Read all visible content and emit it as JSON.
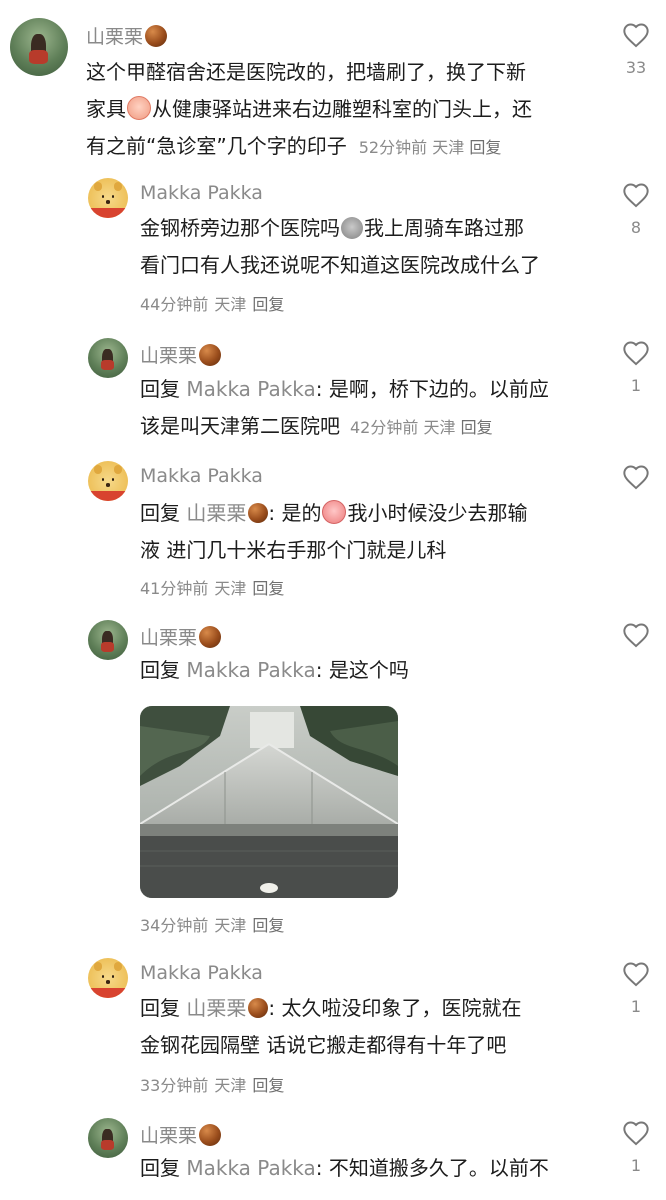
{
  "comments": [
    {
      "username": "山栗栗",
      "text": [
        "这个甲醛宿舍还是医院改的，把墙刷了，换了下新",
        "家具",
        "从健康驿站进来右边雕塑科室的门头上，还",
        "有之前“急诊室”几个字的印子"
      ],
      "time": "52分钟前",
      "location": "天津",
      "reply_label": "回复",
      "likes": "33"
    },
    {
      "username": "Makka Pakka",
      "text": [
        "金钢桥旁边那个医院吗",
        "我上周骑车路过那",
        "看门口有人我还说呢不知道这医院改成什么了"
      ],
      "time": "44分钟前",
      "location": "天津",
      "reply_label": "回复",
      "likes": "8"
    },
    {
      "username": "山栗栗",
      "reply_prefix": "回复",
      "reply_to": "Makka Pakka",
      "text": [
        ": 是啊，桥下边的。以前应",
        "该是叫天津第二医院吧"
      ],
      "time": "42分钟前",
      "location": "天津",
      "reply_label": "回复",
      "likes": "1"
    },
    {
      "username": "Makka Pakka",
      "reply_prefix": "回复",
      "reply_to": "山栗栗",
      "text": [
        ": 是的",
        "我小时候没少去那输",
        "液 进门几十米右手那个门就是儿科"
      ],
      "time": "41分钟前",
      "location": "天津",
      "reply_label": "回复",
      "likes": ""
    },
    {
      "username": "山栗栗",
      "reply_prefix": "回复",
      "reply_to": "Makka Pakka",
      "text": [
        ": 是这个吗"
      ],
      "time": "34分钟前",
      "location": "天津",
      "reply_label": "回复",
      "likes": ""
    },
    {
      "username": "Makka Pakka",
      "reply_prefix": "回复",
      "reply_to": "山栗栗",
      "text": [
        ": 太久啦没印象了，医院就在",
        "金钢花园隔壁 话说它搬走都得有十年了吧"
      ],
      "time": "33分钟前",
      "location": "天津",
      "reply_label": "回复",
      "likes": "1"
    },
    {
      "username": "山栗栗",
      "reply_prefix": "回复",
      "reply_to": "Makka Pakka",
      "text": [
        ": 不知道搬多久了。以前不"
      ],
      "likes": "1"
    }
  ],
  "colors": {
    "meta_gray": "#8a8a8a",
    "text_dark": "#1c1c1c",
    "heart_stroke": "#777777"
  }
}
